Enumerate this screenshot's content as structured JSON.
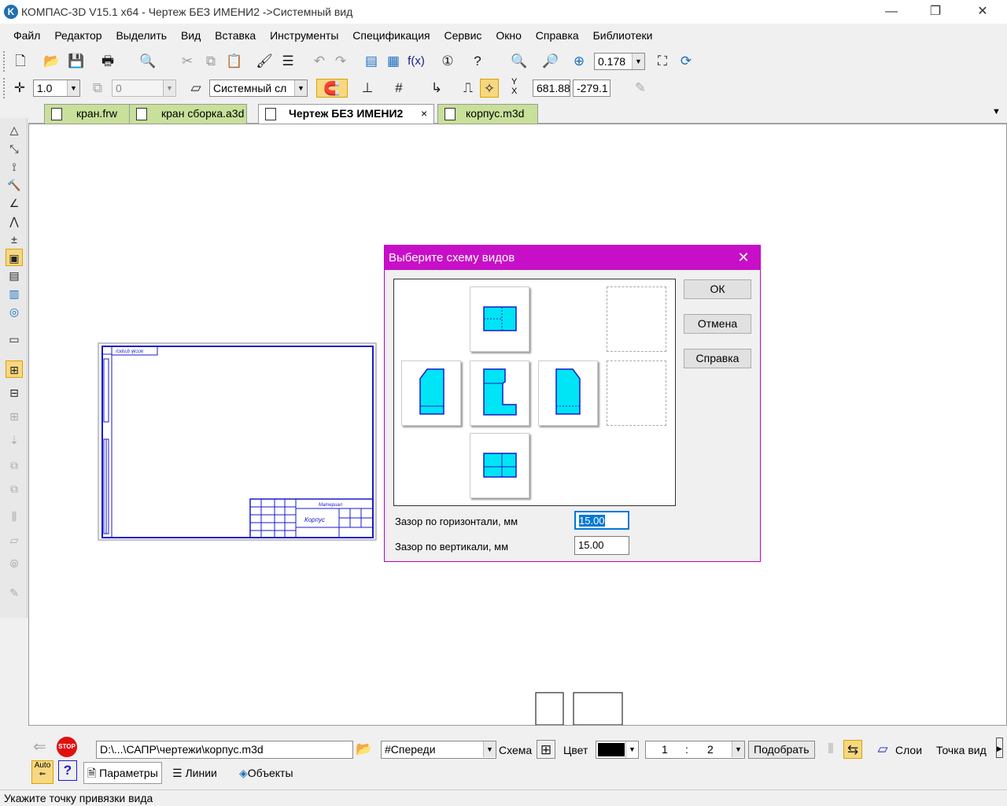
{
  "window": {
    "title": "КОМПАС-3D V15.1 x64 - Чертеж БЕЗ ИМЕНИ2 ->Системный вид",
    "logo": "K",
    "minimize": "—",
    "maximize": "❐",
    "close": "✕"
  },
  "menu": [
    "Файл",
    "Редактор",
    "Выделить",
    "Вид",
    "Вставка",
    "Инструменты",
    "Спецификация",
    "Сервис",
    "Окно",
    "Справка",
    "Библиотеки"
  ],
  "toolbar1": {
    "zoom_value": "0.178"
  },
  "toolbar2": {
    "scale": "1.0",
    "step": "0",
    "layer": "Системный сл",
    "coord_x": "681.88",
    "coord_y": "-279.1",
    "xy_label_y": "Y",
    "xy_label_x": "X"
  },
  "tabs": [
    {
      "label": "кран.frw",
      "active": false
    },
    {
      "label": "кран сборка.a3d",
      "active": false
    },
    {
      "label": "Чертеж БЕЗ ИМЕНИ2",
      "active": true,
      "close": "×"
    },
    {
      "label": "корпус.m3d",
      "active": false
    }
  ],
  "tabs_dropdown": "▼",
  "sheet": {
    "stamp_top": "ʎɔdu¡ɓ ʞɐɔɔɐ",
    "stamp_name": "Корпус",
    "stamp_label": "Материал"
  },
  "dialog": {
    "title": "Выберите схему видов",
    "close": "✕",
    "ok": "ОК",
    "cancel": "Отмена",
    "help": "Справка",
    "gap_h_label": "Зазор по горизонтали, мм",
    "gap_h_value": "15.00",
    "gap_v_label": "Зазор по вертикали, мм",
    "gap_v_value": "15.00",
    "accent_color": "#c80fc8",
    "view_color": "#00e5f5",
    "view_stroke": "#1a1acc"
  },
  "propbar": {
    "stop": "STOP",
    "auto": "Auto",
    "help": "?",
    "file_path": "D:\\...\\САПР\\чертежи\\корпус.m3d",
    "orientation": "#Спереди",
    "scheme": "Схема",
    "color": "Цвет",
    "scale_a": "1",
    "scale_sep": ":",
    "scale_b": "2",
    "fit": "Подобрать",
    "layers": "Слои",
    "point": "Точка вид",
    "tab_params": "Параметры",
    "tab_lines": "Линии",
    "tab_objects": "Объекты"
  },
  "status": "Укажите точку привязки вида"
}
